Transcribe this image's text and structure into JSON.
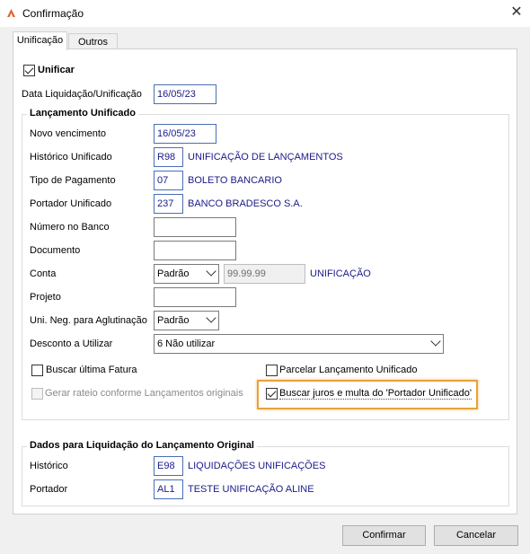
{
  "window": {
    "title": "Confirmação",
    "close_icon": "close-icon",
    "app_icon": "app-logo-icon"
  },
  "tabs": [
    {
      "label": "Unificação"
    },
    {
      "label": "Outros"
    }
  ],
  "unificar": {
    "label": "Unificar",
    "checked": true
  },
  "data_liquidacao": {
    "label": "Data Liquidação/Unificação",
    "value": "16/05/23"
  },
  "lancamento": {
    "title": "Lançamento Unificado",
    "novo_vencimento": {
      "label": "Novo vencimento",
      "value": "16/05/23"
    },
    "historico": {
      "label": "Histórico Unificado",
      "code": "R98",
      "desc": "UNIFICAÇÃO DE LANÇAMENTOS"
    },
    "tipo_pagamento": {
      "label": "Tipo de Pagamento",
      "code": "07",
      "desc": "BOLETO BANCARIO"
    },
    "portador": {
      "label": "Portador Unificado",
      "code": "237",
      "desc": "BANCO BRADESCO S.A."
    },
    "numero_banco": {
      "label": "Número no Banco",
      "value": ""
    },
    "documento": {
      "label": "Documento",
      "value": ""
    },
    "conta": {
      "label": "Conta",
      "select": "Padrão",
      "code": "99.99.99",
      "desc": "UNIFICAÇÃO"
    },
    "projeto": {
      "label": "Projeto",
      "value": ""
    },
    "uni_neg": {
      "label": "Uni. Neg. para Aglutinação",
      "select": "Padrão"
    },
    "desconto": {
      "label": "Desconto a Utilizar",
      "select": "6 Não utilizar"
    },
    "buscar_ultima": {
      "label": "Buscar última Fatura",
      "checked": false
    },
    "parcelar": {
      "label": "Parcelar Lançamento Unificado",
      "checked": false
    },
    "gerar_rateio": {
      "label": "Gerar rateio conforme Lançamentos originais",
      "checked": false,
      "enabled": false
    },
    "buscar_juros": {
      "label": "Buscar juros e multa do 'Portador Unificado'",
      "checked": true
    }
  },
  "original": {
    "title": "Dados para Liquidação do Lançamento Original",
    "historico": {
      "label": "Histórico",
      "code": "E98",
      "desc": "LIQUIDAÇÕES UNIFICAÇÕES"
    },
    "portador": {
      "label": "Portador",
      "code": "AL1",
      "desc": "TESTE UNIFICAÇÃO ALINE"
    }
  },
  "buttons": {
    "confirm": "Confirmar",
    "cancel": "Cancelar"
  },
  "colors": {
    "highlight": "#e8a13a",
    "value_text": "#1a1a8a"
  }
}
